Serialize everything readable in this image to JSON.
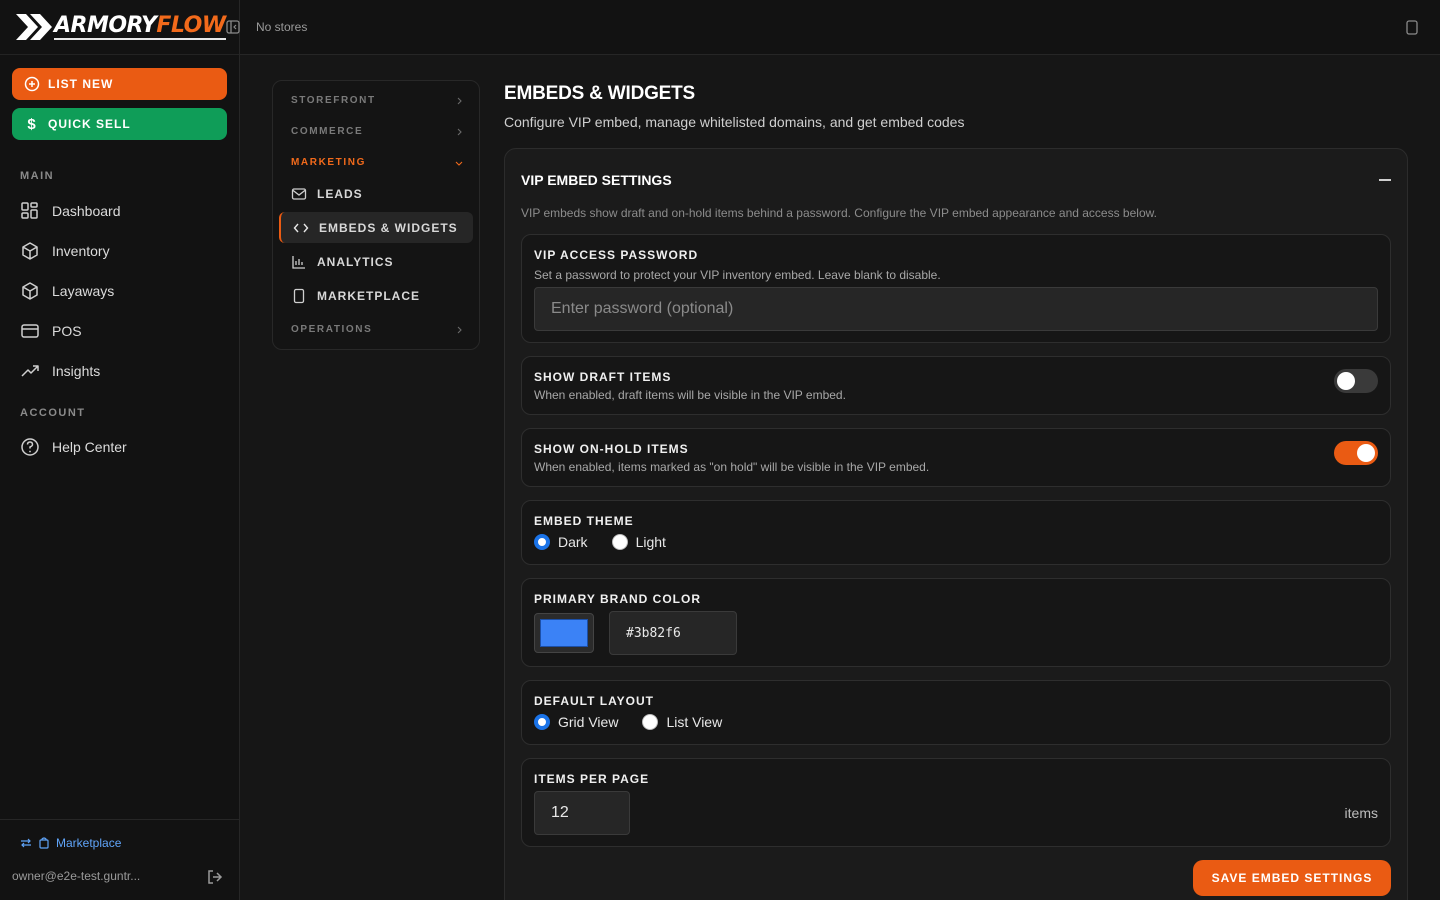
{
  "brand": {
    "part1": "ARMORY",
    "part2": "FLOW"
  },
  "topbar": {
    "store_text": "No stores"
  },
  "actions": {
    "list_new": "LIST NEW",
    "quick_sell": "QUICK SELL"
  },
  "sidebar": {
    "main_label": "MAIN",
    "items": [
      "Dashboard",
      "Inventory",
      "Layaways",
      "POS",
      "Insights"
    ],
    "account_label": "ACCOUNT",
    "help": "Help Center",
    "marketplace": "Marketplace",
    "user_email": "owner@e2e-test.guntr..."
  },
  "settings_nav": {
    "storefront": "STOREFRONT",
    "commerce": "COMMERCE",
    "marketing": "MARKETING",
    "leads": "LEADS",
    "embeds": "EMBEDS & WIDGETS",
    "analytics": "ANALYTICS",
    "marketplace": "MARKETPLACE",
    "operations": "OPERATIONS"
  },
  "page": {
    "title": "EMBEDS & WIDGETS",
    "subtitle": "Configure VIP embed, manage whitelisted domains, and get embed codes"
  },
  "vip": {
    "title": "VIP EMBED SETTINGS",
    "description": "VIP embeds show draft and on-hold items behind a password. Configure the VIP embed appearance and access below.",
    "password_label": "VIP ACCESS PASSWORD",
    "password_desc": "Set a password to protect your VIP inventory embed. Leave blank to disable.",
    "password_placeholder": "Enter password (optional)",
    "draft_label": "SHOW DRAFT ITEMS",
    "draft_desc": "When enabled, draft items will be visible in the VIP embed.",
    "draft_enabled": false,
    "onhold_label": "SHOW ON-HOLD ITEMS",
    "onhold_desc": "When enabled, items marked as \"on hold\" will be visible in the VIP embed.",
    "onhold_enabled": true,
    "theme_label": "EMBED THEME",
    "theme_dark": "Dark",
    "theme_light": "Light",
    "theme_selected": "Dark",
    "color_label": "PRIMARY BRAND COLOR",
    "color_value": "#3b82f6",
    "layout_label": "DEFAULT LAYOUT",
    "layout_grid": "Grid View",
    "layout_list": "List View",
    "layout_selected": "Grid View",
    "per_page_label": "ITEMS PER PAGE",
    "per_page_value": "12",
    "per_page_suffix": "items",
    "save": "SAVE EMBED SETTINGS"
  },
  "colors": {
    "accent": "#ea5b13",
    "success": "#0f9d58",
    "link": "#60a5fa",
    "brand_color": "#3b82f6"
  }
}
